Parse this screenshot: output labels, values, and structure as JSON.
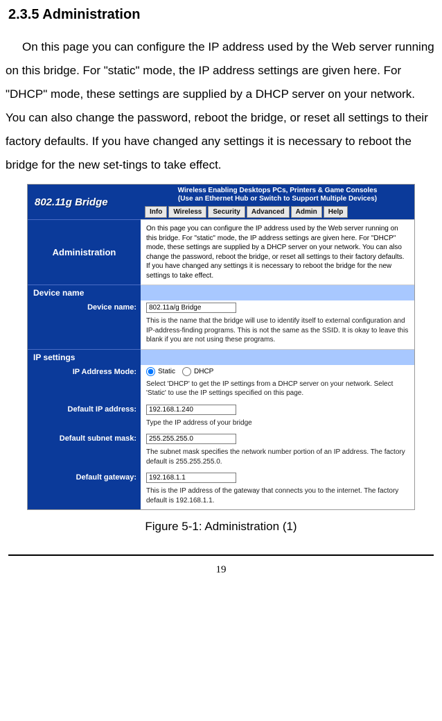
{
  "doc": {
    "heading": "2.3.5 Administration",
    "para": "On this page you can configure the IP address used by the Web server running on this bridge. For \"static\" mode, the IP address settings are given here. For \"DHCP\" mode, these settings are supplied by a DHCP server on your network. You can also change the password, reboot the bridge, or reset all settings to their factory defaults. If you have changed any settings it is necessary to reboot the bridge for the new set-tings to take effect.",
    "figure_caption": "Figure 5-1: Administration (1)",
    "page_number": "19"
  },
  "ui": {
    "banner_left": "802.11g Bridge",
    "banner_tag_l1": "Wireless Enabling Desktops PCs, Printers & Game Consoles",
    "banner_tag_l2": "(Use an Ethernet Hub or Switch to Support Multiple Devices)",
    "tabs": [
      "Info",
      "Wireless",
      "Security",
      "Advanced",
      "Admin",
      "Help"
    ],
    "admin_label": "Administration",
    "admin_desc": "On this page you can configure the IP address used by the Web server running on this bridge. For \"static\" mode, the IP address settings are given here. For \"DHCP\" mode, these settings are supplied by a DHCP server on your network. You can also change the password, reboot the bridge, or reset all settings to their factory defaults. If you have changed any settings it is necessary to reboot the bridge for the new settings to take effect.",
    "group_device": "Device name",
    "device_name_label": "Device name:",
    "device_name_value": "802.11a/g Bridge",
    "device_name_help": "This is the name that the bridge will use to identify itself to external configuration and IP-address-finding programs. This is not the same as the SSID. It is okay to leave this blank if you are not using these programs.",
    "group_ip": "IP settings",
    "ip_mode_label": "IP Address Mode:",
    "ip_mode_static": "Static",
    "ip_mode_dhcp": "DHCP",
    "ip_mode_help": "Select 'DHCP' to get the IP settings from a DHCP server on your network. Select 'Static' to use the IP settings specified on this page.",
    "ip_addr_label": "Default IP address:",
    "ip_addr_value": "192.168.1.240",
    "ip_addr_help": "Type the IP address of your bridge",
    "subnet_label": "Default subnet mask:",
    "subnet_value": "255.255.255.0",
    "subnet_help": "The subnet mask specifies the network number portion of an IP address. The factory default is 255.255.255.0.",
    "gateway_label": "Default gateway:",
    "gateway_value": "192.168.1.1",
    "gateway_help": "This is the IP address of the gateway that connects you to the internet. The factory default is 192.168.1.1."
  }
}
